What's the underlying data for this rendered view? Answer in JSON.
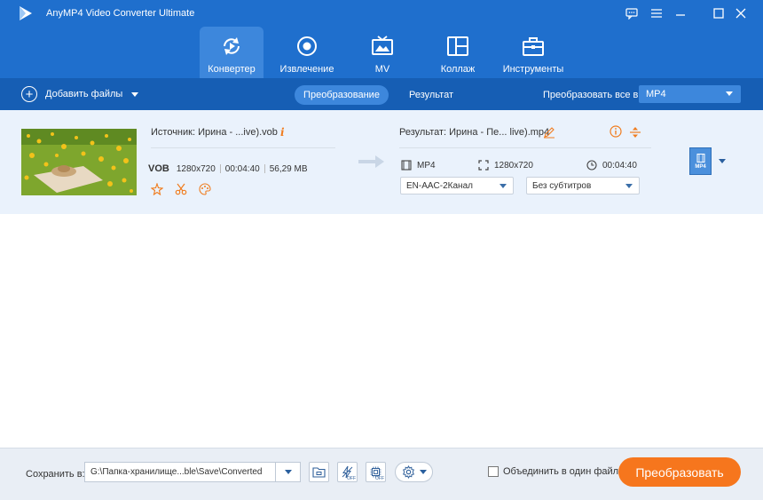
{
  "window": {
    "title": "AnyMP4 Video Converter Ultimate",
    "controls": [
      "chat-icon",
      "menu-icon",
      "minimize-icon",
      "maximize-icon",
      "close-icon"
    ]
  },
  "tabs": [
    {
      "label": "Конвертер",
      "icon": "convert-icon",
      "active": true
    },
    {
      "label": "Извлечение",
      "icon": "record-icon",
      "active": false
    },
    {
      "label": "MV",
      "icon": "tv-icon",
      "active": false
    },
    {
      "label": "Коллаж",
      "icon": "collage-icon",
      "active": false
    },
    {
      "label": "Инструменты",
      "icon": "toolbox-icon",
      "active": false
    }
  ],
  "toolbar": {
    "add_files": "Добавить файлы",
    "convert_tab": "Преобразование",
    "result_tab": "Результат",
    "convert_all_label": "Преобразовать все в:",
    "convert_all_value": "MP4"
  },
  "file": {
    "source_name": "Источник: Ирина - ...ive).vob",
    "format": "VOB",
    "resolution": "1280x720",
    "duration": "00:04:40",
    "size": "56,29 MB",
    "result_name": "Результат: Ирина - Пе... live).mp4",
    "result_format": "MP4",
    "result_resolution": "1280x720",
    "result_duration": "00:04:40",
    "audio_track": "EN-AAC-2Канал",
    "subtitle": "Без субтитров",
    "format_badge": "MP4"
  },
  "footer": {
    "save_label": "Сохранить в:",
    "save_path": "G:\\Папка-хранилище...ble\\Save\\Converted",
    "merge_label": "Объединить в один файл",
    "convert_button": "Преобразовать",
    "speed_off": "OFF",
    "hw_off": "OFF"
  },
  "colors": {
    "header": "#1f6fcd",
    "toolbar": "#165eb4",
    "accent": "#f6761d",
    "row_bg": "#eaf2fc"
  }
}
